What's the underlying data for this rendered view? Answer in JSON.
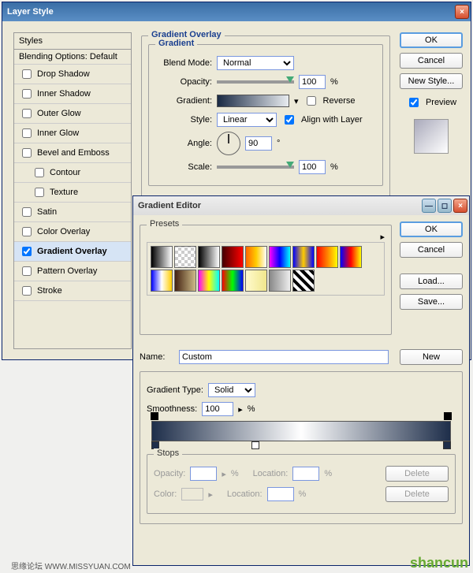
{
  "layerStyle": {
    "title": "Layer Style",
    "stylesHeader": "Styles",
    "blendingOptions": "Blending Options: Default",
    "items": [
      {
        "label": "Drop Shadow",
        "checked": false
      },
      {
        "label": "Inner Shadow",
        "checked": false
      },
      {
        "label": "Outer Glow",
        "checked": false
      },
      {
        "label": "Inner Glow",
        "checked": false
      },
      {
        "label": "Bevel and Emboss",
        "checked": false
      },
      {
        "label": "Contour",
        "checked": false,
        "sub": true
      },
      {
        "label": "Texture",
        "checked": false,
        "sub": true
      },
      {
        "label": "Satin",
        "checked": false
      },
      {
        "label": "Color Overlay",
        "checked": false
      },
      {
        "label": "Gradient Overlay",
        "checked": true,
        "selected": true
      },
      {
        "label": "Pattern Overlay",
        "checked": false
      },
      {
        "label": "Stroke",
        "checked": false
      }
    ],
    "section": {
      "title": "Gradient Overlay",
      "subTitle": "Gradient",
      "blendModeLbl": "Blend Mode:",
      "blendMode": "Normal",
      "opacityLbl": "Opacity:",
      "opacity": "100",
      "gradientLbl": "Gradient:",
      "reverseLbl": "Reverse",
      "styleLbl": "Style:",
      "style": "Linear",
      "alignLbl": "Align with Layer",
      "angleLbl": "Angle:",
      "angle": "90",
      "scaleLbl": "Scale:",
      "scale": "100",
      "pct": "%",
      "deg": "°"
    },
    "buttons": {
      "ok": "OK",
      "cancel": "Cancel",
      "newStyle": "New Style...",
      "previewLbl": "Preview"
    }
  },
  "gradientEditor": {
    "title": "Gradient Editor",
    "presetsLbl": "Presets",
    "nameLbl": "Name:",
    "name": "Custom",
    "gradTypeLbl": "Gradient Type:",
    "gradType": "Solid",
    "smoothLbl": "Smoothness:",
    "smooth": "100",
    "pct": "%",
    "buttons": {
      "ok": "OK",
      "cancel": "Cancel",
      "load": "Load...",
      "save": "Save...",
      "new": "New"
    },
    "stops": {
      "title": "Stops",
      "opacityLbl": "Opacity:",
      "locationLbl": "Location:",
      "colorLbl": "Color:",
      "delete": "Delete",
      "pct": "%"
    },
    "presetGradients": [
      "linear-gradient(90deg,#000,#fff)",
      "repeating-conic-gradient(#ccc 0 25%,#fff 0 50%) 0/8px 8px",
      "linear-gradient(90deg,#000,#fff)",
      "linear-gradient(90deg,#400,#f00)",
      "linear-gradient(90deg,#f60,#fc0,#fff)",
      "linear-gradient(90deg,#f0f,#00f,#0ff)",
      "linear-gradient(90deg,#00f,#fc0,#00f)",
      "linear-gradient(90deg,#f00,#ff0)",
      "linear-gradient(90deg,#00f,#f00,#ff0)",
      "linear-gradient(90deg,#00f,#fff,#fc0)",
      "linear-gradient(90deg,#421,#cb8)",
      "linear-gradient(90deg,#f0f,#ff0,#0ff)",
      "linear-gradient(90deg,#f00,#0f0,#00f)",
      "linear-gradient(90deg,#fffacd,#f0e68c)",
      "linear-gradient(90deg,#888,#eee)",
      "repeating-linear-gradient(45deg,#000 0 4px,#fff 4px 8px)"
    ]
  },
  "footer": {
    "left": "思缘论坛  WWW.MISSYUAN.COM",
    "right": "shancun"
  }
}
